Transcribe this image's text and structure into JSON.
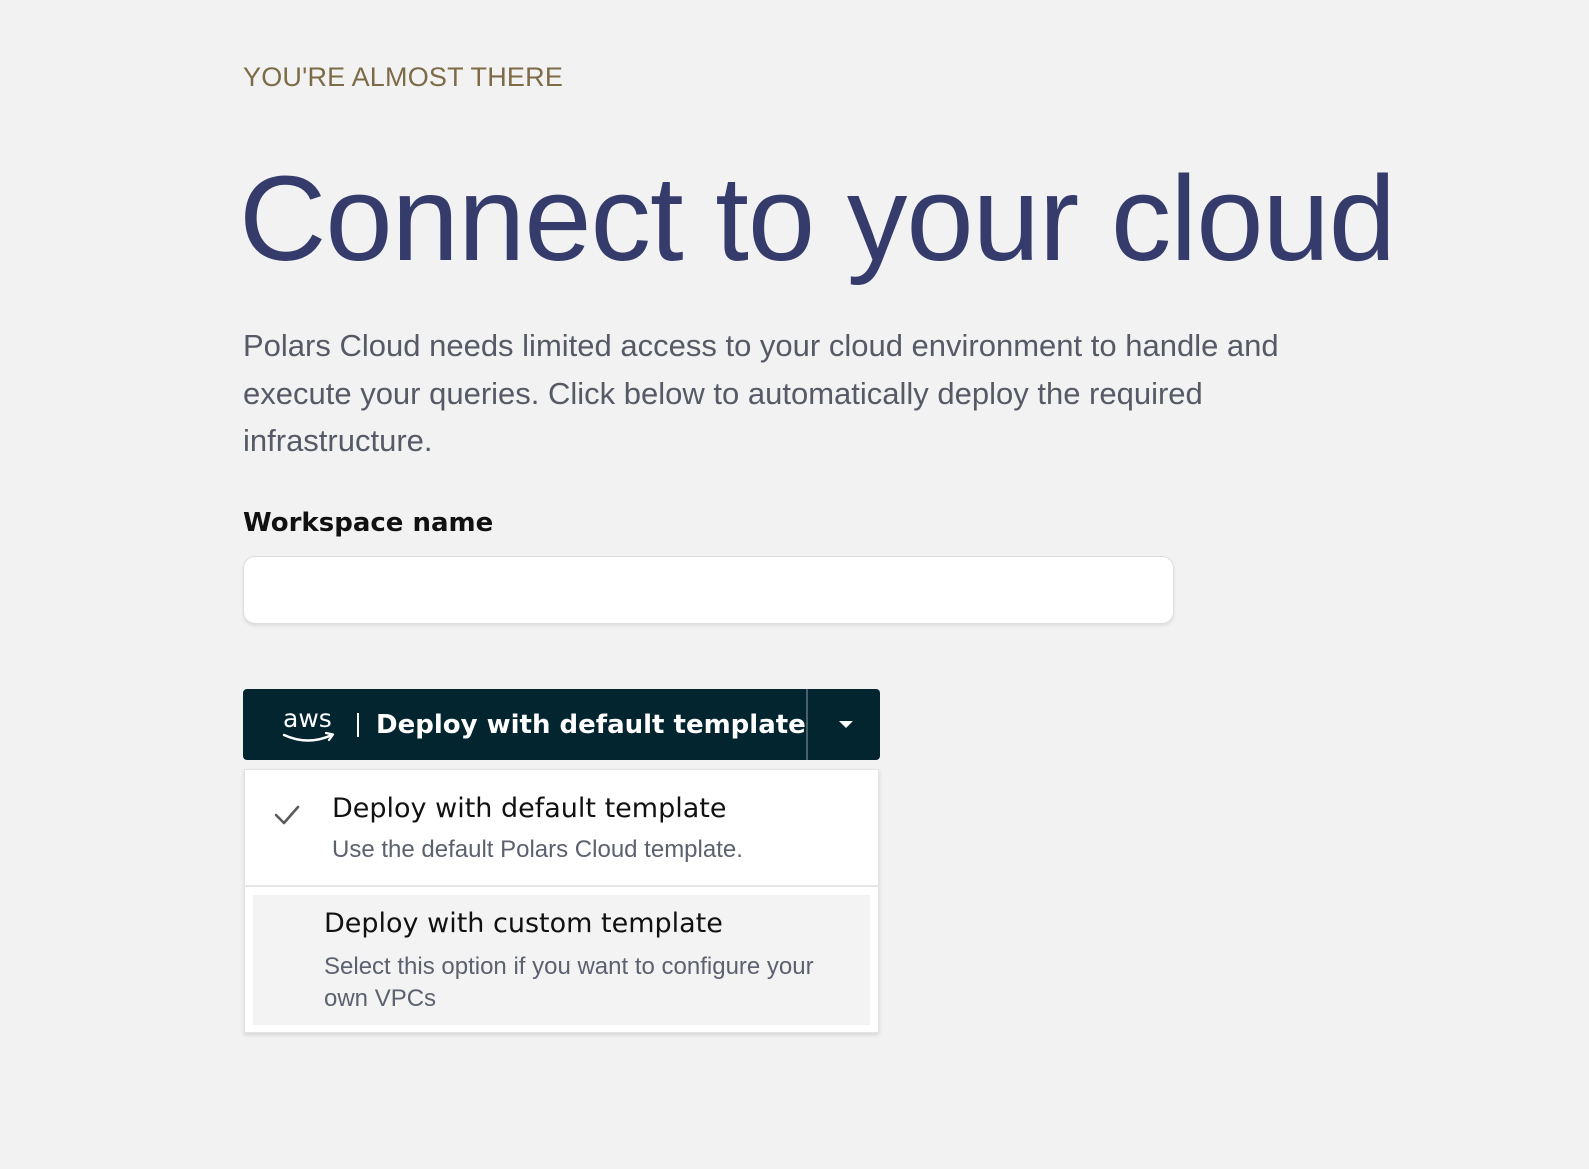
{
  "header": {
    "eyebrow": "YOU'RE ALMOST THERE",
    "title": "Connect to your cloud",
    "intro": "Polars Cloud needs limited access to your cloud environment to handle and execute your queries. Click below to automatically deploy the required infrastructure."
  },
  "form": {
    "workspace_label": "Workspace name",
    "workspace_value": "",
    "workspace_placeholder": ""
  },
  "deploy": {
    "provider_logo": "aws",
    "button_label": "Deploy with default template",
    "toggle_icon": "caret-down-icon",
    "menu": {
      "options": [
        {
          "title": "Deploy with default template",
          "description": "Use the default Polars Cloud template.",
          "selected": true
        },
        {
          "title": "Deploy with custom template",
          "description": "Select this option if you want to configure your own VPCs",
          "selected": false,
          "highlighted": true
        }
      ]
    }
  },
  "colors": {
    "background": "#f2f2f2",
    "eyebrow": "#7d6b47",
    "title": "#353b6b",
    "body_text": "#555a66",
    "button_bg": "#032530",
    "menu_hover": "#f3f3f3"
  }
}
